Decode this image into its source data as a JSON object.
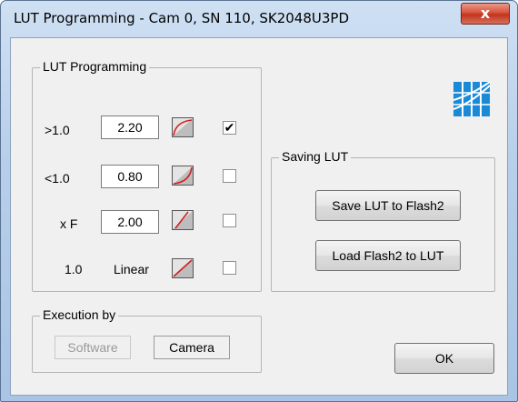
{
  "window": {
    "title": "LUT Programming - Cam 0, SN 110, SK2048U3PD",
    "close_label": "x"
  },
  "lut_group": {
    "label": "LUT Programming",
    "rows": [
      {
        "label": ">1.0",
        "value": "2.20",
        "checked": true,
        "check_mark": "✔"
      },
      {
        "label": "<1.0",
        "value": "0.80",
        "checked": false,
        "check_mark": ""
      },
      {
        "label": "x F",
        "value": "2.00",
        "checked": false,
        "check_mark": ""
      },
      {
        "label": "1.0",
        "value": "Linear",
        "checked": false,
        "check_mark": ""
      }
    ]
  },
  "saving_group": {
    "label": "Saving LUT",
    "save_button": "Save LUT to Flash2",
    "load_button": "Load Flash2 to LUT"
  },
  "execution_group": {
    "label": "Execution by",
    "software": "Software",
    "camera": "Camera"
  },
  "ok_button": "OK",
  "colors": {
    "curve_red": "#d21f1f",
    "logo_blue": "#1a8ad6"
  }
}
